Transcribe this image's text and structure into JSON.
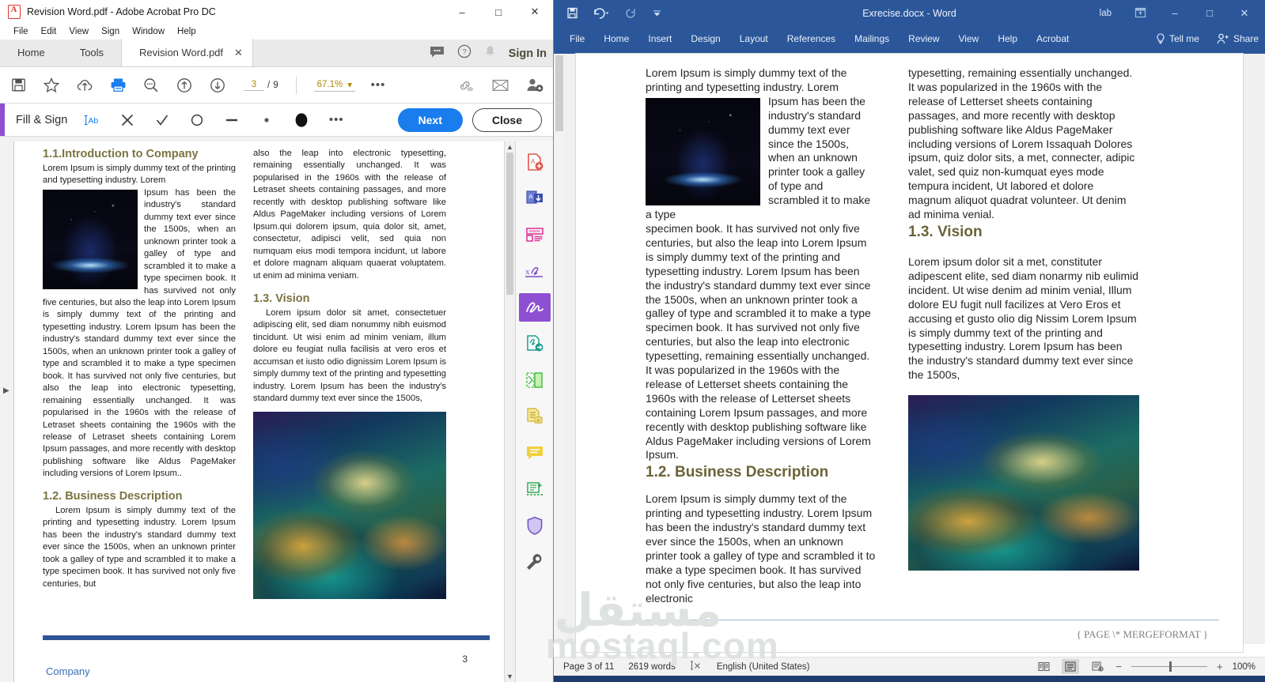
{
  "acrobat": {
    "window_title": "Revision Word.pdf - Adobe Acrobat Pro DC",
    "doc_icon": "pdf-file-icon",
    "window_buttons": {
      "minimize": "–",
      "maximize": "□",
      "close": "✕"
    },
    "menu": [
      "File",
      "Edit",
      "View",
      "Sign",
      "Window",
      "Help"
    ],
    "tabs": {
      "home": "Home",
      "tools": "Tools",
      "document": "Revision Word.pdf",
      "close_tab": "✕"
    },
    "header_right": {
      "comment_icon": "comment-icon",
      "help_icon": "help-icon",
      "bell_icon": "notification-bell-icon",
      "sign_in": "Sign In"
    },
    "toolbar": {
      "icons": [
        "save-icon",
        "star-icon",
        "upload-cloud-icon",
        "print-icon",
        "zoom-search-icon",
        "previous-page-icon",
        "next-page-icon"
      ],
      "page_current": "3",
      "page_sep": "/",
      "page_total": "9",
      "zoom_level": "67.1%",
      "zoom_caret": "▾",
      "more_icon": "•••",
      "right_icons": [
        "link-icon",
        "email-icon",
        "add-person-icon"
      ]
    },
    "fill_sign": {
      "label": "Fill & Sign",
      "tools": [
        "text-field-icon",
        "cross-mark-icon",
        "check-mark-icon",
        "circle-icon",
        "line-icon",
        "small-dot-icon",
        "filled-dot-icon",
        "more-options-icon"
      ],
      "text_tool_label": "Ab",
      "next_label": "Next",
      "close_label": "Close"
    },
    "right_tools": [
      "create-pdf-icon",
      "export-pdf-icon",
      "edit-pdf-icon",
      "redact-icon",
      "fill-sign-icon",
      "send-for-signature-icon",
      "compare-files-icon",
      "organize-pages-icon",
      "comment-icon",
      "scan-ocr-icon",
      "protect-icon",
      "tools-wrench-icon"
    ],
    "scrollbar": {
      "up": "▲",
      "down": "▼"
    },
    "page": {
      "col_left": {
        "heading1": "1.1.Introduction to Company",
        "para1a": "Lorem Ipsum is simply dummy text of the printing and typesetting industry. Lorem",
        "para1b": "Ipsum has been the industry's standard dummy text ever since the 1500s, when an unknown printer took a galley of type and scrambled it to make a type specimen book. It has survived not only five centuries, but also the leap into Lorem Ipsum is simply dummy text of the printing and typesetting industry. Lorem Ipsum has been the industry's standard dummy text ever since the 1500s, when an unknown printer took a galley of type and scrambled it to make a type specimen book. It has survived not only five centuries, but also the leap into electronic typesetting, remaining essentially unchanged. It was popularised in the 1960s with the release of Letraset sheets containing the 1960s with the release of Letraset sheets containing Lorem Ipsum passages, and more recently with desktop publishing software like Aldus PageMaker including versions of Lorem Ipsum..",
        "heading2": "1.2. Business Description",
        "para2": "Lorem Ipsum is simply dummy text of the printing and typesetting industry. Lorem Ipsum has been the industry's standard dummy text ever since the 1500s, when an unknown printer took a galley of type and scrambled it to make a type specimen book. It has survived not only five centuries, but",
        "image": "space-nebula-image"
      },
      "col_right": {
        "para1": "also the leap into electronic typesetting, remaining essentially unchanged. It was popularised in the 1960s with the release of Letraset sheets containing passages, and more recently with desktop publishing software like Aldus PageMaker including versions of Lorem Ipsum.qui dolorem ipsum, quia dolor sit, amet, consectetur, adipisci velit, sed quia non numquam eius modi tempora incidunt, ut labore et dolore magnam aliquam quaerat voluptatem. ut enim ad minima veniam.",
        "heading": "1.3. Vision",
        "para2": "Lorem ipsum dolor sit amet, consectetuer adipiscing elit, sed diam nonummy nibh euismod tincidunt. Ut wisi enim ad minim veniam, illum dolore eu feugiat nulla facilisis at vero eros et accumsan et iusto odio dignissim Lorem Ipsum is simply dummy text of the printing and typesetting industry. Lorem Ipsum has been the industry's standard dummy text ever since the 1500s,",
        "image": "europe-at-night-satellite-image"
      },
      "footer_text": "Company",
      "footer_page": "3"
    }
  },
  "word": {
    "title": "Exrecise.docx  -  Word",
    "quick_access": [
      "save-icon",
      "undo-icon",
      "redo-icon",
      "customize-qat-icon"
    ],
    "user_label": "lab",
    "ribbon_display_icon": "ribbon-display-options-icon",
    "window_buttons": {
      "minimize": "–",
      "maximize": "□",
      "close": "✕"
    },
    "ribbon_tabs": [
      "File",
      "Home",
      "Insert",
      "Design",
      "Layout",
      "References",
      "Mailings",
      "Review",
      "View",
      "Help",
      "Acrobat"
    ],
    "tell_me": "Tell me",
    "share": "Share",
    "document": {
      "col_left": {
        "para1a": "Lorem Ipsum is simply dummy text of the printing and typesetting industry. Lorem",
        "para1b": "Ipsum has been the industry's standard dummy text ever since the 1500s, when an unknown printer took a galley of type and scrambled it to make a type",
        "para1c": "specimen book. It has survived not only five centuries, but also the leap into Lorem Ipsum is simply dummy text of the printing and typesetting industry. Lorem Ipsum has been the industry's standard dummy text ever since the 1500s, when an unknown printer took a galley of type and scrambled it to make a type specimen book. It has survived not only five centuries, but also the leap into electronic typesetting, remaining essentially unchanged. It was popularized in the 1960s with the release of Letterset sheets containing the 1960s with the release of Letterset sheets containing Lorem Ipsum passages, and more recently with desktop publishing software like Aldus PageMaker including versions of Lorem Ipsum.",
        "heading": "1.2. Business Description",
        "para2": "Lorem Ipsum is simply dummy text of the printing and typesetting industry. Lorem Ipsum has been the industry's standard dummy text ever since the 1500s, when an unknown printer took a galley of type and scrambled it to make a type specimen book. It has survived not only five centuries, but also the leap into electronic",
        "image": "space-nebula-image"
      },
      "col_right": {
        "para1": "typesetting, remaining essentially unchanged. It was popularized in the 1960s with the release of Letterset sheets containing passages, and more recently with desktop publishing software like Aldus PageMaker including versions of Lorem Issaquah Dolores ipsum, quiz dolor sits, a met, connecter, adipic valet, sed quiz non-kumquat eyes mode tempura incident, Ut labored et dolore magnum aliquot quadrat volunteer. Ut denim ad minima venial.",
        "heading": "1.3. Vision",
        "para2": "Lorem ipsum dolor sit a met, constituter adipescent elite, sed diam nonarmy nib eulimid incident. Ut wise denim ad minim venial, Illum dolore EU fugit null facilizes at Vero Eros et accusing et gusto olio dig Nissim Lorem Ipsum is simply dummy text of the printing and typesetting industry. Lorem Ipsum has been the industry's standard dummy text ever since the 1500s,",
        "image": "europe-at-night-satellite-image"
      },
      "footer_field": "{ PAGE  \\* MERGEFORMAT }"
    },
    "status_bar": {
      "page": "Page 3 of 11",
      "words": "2619 words",
      "proofing_icon": "proofing-errors-icon",
      "language": "English (United States)",
      "view_icons": [
        "read-mode-icon",
        "print-layout-icon",
        "web-layout-icon"
      ],
      "zoom_out": "−",
      "zoom_in": "+",
      "zoom_value": "100%"
    }
  },
  "watermark": {
    "arabic": "مستقل",
    "latin": "mostaql.com"
  }
}
